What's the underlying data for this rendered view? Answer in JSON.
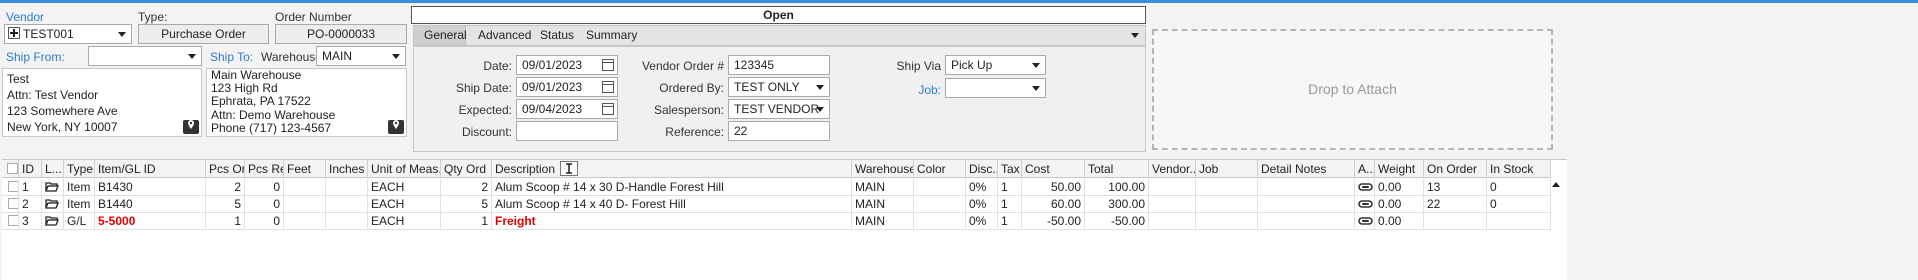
{
  "header": {
    "vendor_label": "Vendor",
    "vendor_value": "TEST001",
    "type_label": "Type:",
    "type_value": "Purchase Order",
    "order_label": "Order Number",
    "order_value": "PO-0000033",
    "status_value": "Open"
  },
  "ship_from": {
    "label": "Ship From:",
    "value": "",
    "lines": [
      "Test",
      "Attn: Test Vendor",
      "123 Somewhere Ave",
      "New York, NY 10007"
    ]
  },
  "ship_to": {
    "label": "Ship To:",
    "value": "",
    "warehouse_label": "Warehouse:",
    "warehouse_value": "MAIN",
    "lines": [
      "Main Warehouse",
      "123 High Rd",
      "Ephrata, PA 17522",
      "Attn: Demo Warehouse",
      "Phone (717) 123-4567"
    ]
  },
  "tabs": [
    "General",
    "Advanced",
    "Status",
    "Summary"
  ],
  "general": {
    "date_label": "Date:",
    "date_value": "09/01/2023",
    "shipdate_label": "Ship Date:",
    "shipdate_value": "09/01/2023",
    "expected_label": "Expected:",
    "expected_value": "09/04/2023",
    "discount_label": "Discount:",
    "discount_value": "",
    "vendor_order_label": "Vendor Order #",
    "vendor_order_value": "123345",
    "ordered_by_label": "Ordered By:",
    "ordered_by_value": "TEST ONLY",
    "salesperson_label": "Salesperson:",
    "salesperson_value": "TEST VENDOR",
    "reference_label": "Reference:",
    "reference_value": "22",
    "ship_via_label": "Ship Via",
    "ship_via_value": "Pick Up",
    "job_label": "Job:",
    "job_value": ""
  },
  "attach": {
    "text": "Drop to Attach"
  },
  "grid": {
    "columns": [
      "",
      "ID",
      "L...",
      "Type",
      "Item/GL ID",
      "Pcs Ord",
      "Pcs Rec",
      "Feet",
      "Inches",
      "Unit of Meas...",
      "Qty Ord",
      "Description",
      "Warehouse",
      "Color",
      "Disc...",
      "Tax",
      "Cost",
      "Total",
      "Vendor...",
      "Job",
      "Detail Notes",
      "A...",
      "Weight",
      "On Order",
      "In Stock"
    ],
    "rows": [
      {
        "id": "1",
        "type": "Item",
        "item": "B1430",
        "pcs_ord": "2",
        "pcs_rec": "0",
        "feet": "",
        "inches": "",
        "uom": "EACH",
        "qty": "2",
        "desc": "Alum Scoop # 14 x 30 D-Handle Forest Hill",
        "wh": "MAIN",
        "color": "",
        "disc": "0%",
        "tax": "1",
        "cost": "50.00",
        "total": "100.00",
        "vendor": "",
        "job": "",
        "notes": "",
        "weight": "0.00",
        "on_order": "13",
        "in_stock": "0"
      },
      {
        "id": "2",
        "type": "Item",
        "item": "B1440",
        "pcs_ord": "5",
        "pcs_rec": "0",
        "feet": "",
        "inches": "",
        "uom": "EACH",
        "qty": "5",
        "desc": "Alum Scoop # 14 x 40 D- Forest Hill",
        "wh": "MAIN",
        "color": "",
        "disc": "0%",
        "tax": "1",
        "cost": "60.00",
        "total": "300.00",
        "vendor": "",
        "job": "",
        "notes": "",
        "weight": "0.00",
        "on_order": "22",
        "in_stock": "0"
      },
      {
        "id": "3",
        "type": "G/L",
        "item": "5-5000",
        "pcs_ord": "1",
        "pcs_rec": "0",
        "feet": "",
        "inches": "",
        "uom": "EACH",
        "qty": "1",
        "desc": "Freight",
        "wh": "MAIN",
        "color": "",
        "disc": "0%",
        "tax": "1",
        "cost": "-50.00",
        "total": "-50.00",
        "vendor": "",
        "job": "",
        "notes": "",
        "weight": "0.00",
        "on_order": "",
        "in_stock": ""
      }
    ]
  },
  "colors": {
    "accent": "#2f7ad1",
    "top_bar": "#3b8ee0",
    "gl_red": "#e00000"
  }
}
